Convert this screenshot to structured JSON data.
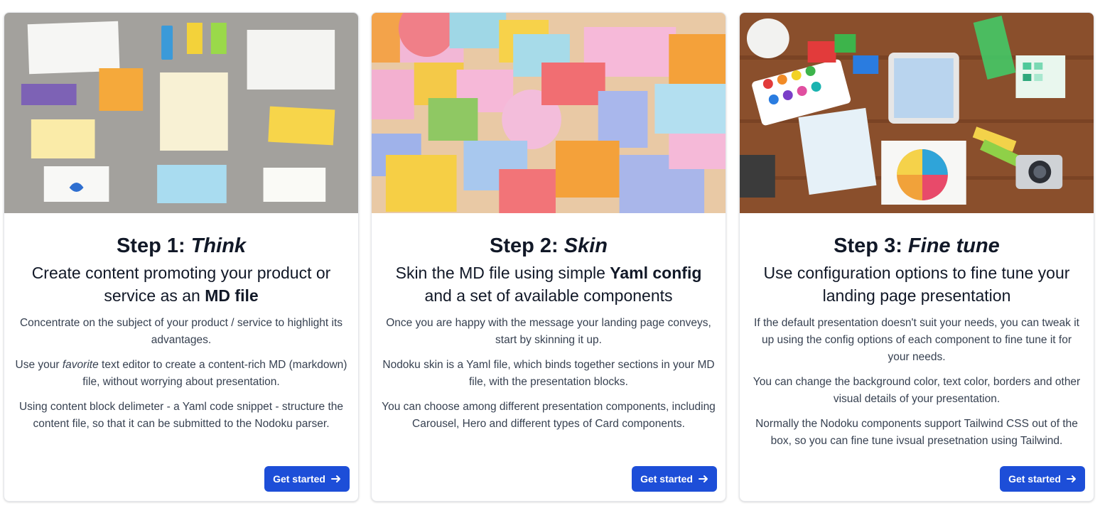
{
  "cards": [
    {
      "title_prefix": "Step 1: ",
      "title_em": "Think",
      "subtitle_a": "Create content promoting your product or service as an ",
      "subtitle_b": "MD file",
      "subtitle_c": "",
      "p1": "Concentrate on the subject of your product / service to highlight its advantages.",
      "p2_a": "Use your ",
      "p2_i": "favorite",
      "p2_b": " text editor to create a content-rich MD (markdown) file, without worrying about presentation.",
      "p3": "Using content block delimeter - a Yaml code snippet - structure the content file, so that it can be submitted to the Nodoku parser.",
      "button": "Get started",
      "button_icon": "arrow-right-icon",
      "image_icon": "sticky-notes-image"
    },
    {
      "title_prefix": "Step 2: ",
      "title_em": "Skin",
      "subtitle_a": "Skin the MD file using simple ",
      "subtitle_b": "Yaml config",
      "subtitle_c": " and a set of available components",
      "p1": "Once you are happy with the message your landing page conveys, start by skinning it up.",
      "p2_a": "Nodoku skin is a Yaml file, which binds together sections in your MD file, with the presentation blocks.",
      "p2_i": "",
      "p2_b": "",
      "p3": "You can choose among different presentation components, including Carousel, Hero and different types of Card components.",
      "button": "Get started",
      "button_icon": "arrow-right-icon",
      "image_icon": "colored-blocks-image"
    },
    {
      "title_prefix": "Step 3: ",
      "title_em": "Fine tune",
      "subtitle_a": "Use configuration options to fine tune your landing page presentation",
      "subtitle_b": "",
      "subtitle_c": "",
      "p1": "If the default presentation doesn't suit your needs, you can tweak it up using the config options of each component to fine tune it for your needs.",
      "p2_a": "You can change the background color, text color, borders and other visual details of your presentation.",
      "p2_i": "",
      "p2_b": "",
      "p3": "Normally the Nodoku components support Tailwind CSS out of the box, so you can fine tune ivsual presetnation using Tailwind.",
      "button": "Get started",
      "button_icon": "arrow-right-icon",
      "image_icon": "design-desk-image"
    }
  ],
  "colors": {
    "button_bg": "#1d4ed8",
    "button_text": "#ffffff",
    "title": "#111827",
    "body_text": "#374151"
  }
}
